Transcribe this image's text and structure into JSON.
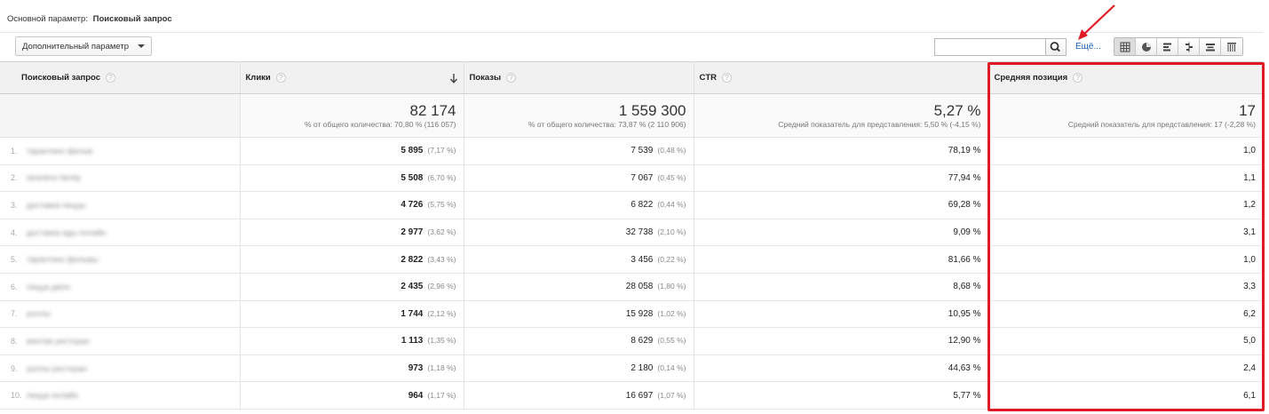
{
  "primary_dimension": {
    "label": "Основной параметр:",
    "value": "Поисковый запрос"
  },
  "secondary_dimension": {
    "label": "Дополнительный параметр"
  },
  "search": {
    "value": "",
    "more_label": "Ещё..."
  },
  "view_buttons": [
    "table-view",
    "pie-view",
    "performance-view",
    "comparison-view",
    "term-cloud-view",
    "pivot-view"
  ],
  "columns": {
    "query": "Поисковый запрос",
    "clicks": "Клики",
    "impressions": "Показы",
    "ctr": "CTR",
    "position": "Средняя позиция"
  },
  "totals": {
    "clicks": {
      "value": "82 174",
      "sub": "% от общего количества: 70,80 % (116 057)"
    },
    "impressions": {
      "value": "1 559 300",
      "sub": "% от общего количества: 73,87 % (2 110 906)"
    },
    "ctr": {
      "value": "5,27 %",
      "sub": "Средний показатель для представления: 5,50 % (-4,15 %)"
    },
    "position": {
      "value": "17",
      "sub": "Средний показатель для представления: 17 (-2,28 %)"
    }
  },
  "rows": [
    {
      "idx": "1.",
      "query": "тарантино фильм",
      "clicks": "5 895",
      "clicks_pct": "(7,17 %)",
      "impressions": "7 539",
      "impressions_pct": "(0,48 %)",
      "ctr": "78,19 %",
      "position": "1,0"
    },
    {
      "idx": "2.",
      "query": "tarantino family",
      "clicks": "5 508",
      "clicks_pct": "(6,70 %)",
      "impressions": "7 067",
      "impressions_pct": "(0,45 %)",
      "ctr": "77,94 %",
      "position": "1,1"
    },
    {
      "idx": "3.",
      "query": "доставка пиццы",
      "clicks": "4 726",
      "clicks_pct": "(5,75 %)",
      "impressions": "6 822",
      "impressions_pct": "(0,44 %)",
      "ctr": "69,28 %",
      "position": "1,2"
    },
    {
      "idx": "4.",
      "query": "доставка еды онлайн",
      "clicks": "2 977",
      "clicks_pct": "(3,62 %)",
      "impressions": "32 738",
      "impressions_pct": "(2,10 %)",
      "ctr": "9,09 %",
      "position": "3,1"
    },
    {
      "idx": "5.",
      "query": "тарантино фильмы",
      "clicks": "2 822",
      "clicks_pct": "(3,43 %)",
      "impressions": "3 456",
      "impressions_pct": "(0,22 %)",
      "ctr": "81,66 %",
      "position": "1,0"
    },
    {
      "idx": "6.",
      "query": "пицца джон",
      "clicks": "2 435",
      "clicks_pct": "(2,96 %)",
      "impressions": "28 058",
      "impressions_pct": "(1,80 %)",
      "ctr": "8,68 %",
      "position": "3,3"
    },
    {
      "idx": "7.",
      "query": "роллы",
      "clicks": "1 744",
      "clicks_pct": "(2,12 %)",
      "impressions": "15 928",
      "impressions_pct": "(1,02 %)",
      "ctr": "10,95 %",
      "position": "6,2"
    },
    {
      "idx": "8.",
      "query": "винтаж ресторан",
      "clicks": "1 113",
      "clicks_pct": "(1,35 %)",
      "impressions": "8 629",
      "impressions_pct": "(0,55 %)",
      "ctr": "12,90 %",
      "position": "5,0"
    },
    {
      "idx": "9.",
      "query": "роллы ресторан",
      "clicks": "973",
      "clicks_pct": "(1,18 %)",
      "impressions": "2 180",
      "impressions_pct": "(0,14 %)",
      "ctr": "44,63 %",
      "position": "2,4"
    },
    {
      "idx": "10.",
      "query": "пицца онлайн",
      "clicks": "964",
      "clicks_pct": "(1,17 %)",
      "impressions": "16 697",
      "impressions_pct": "(1,07 %)",
      "ctr": "5,77 %",
      "position": "6,1"
    }
  ],
  "colors": {
    "highlight": "#e01a25",
    "link": "#1a5fb4",
    "header_bg": "#f1f1f1"
  }
}
